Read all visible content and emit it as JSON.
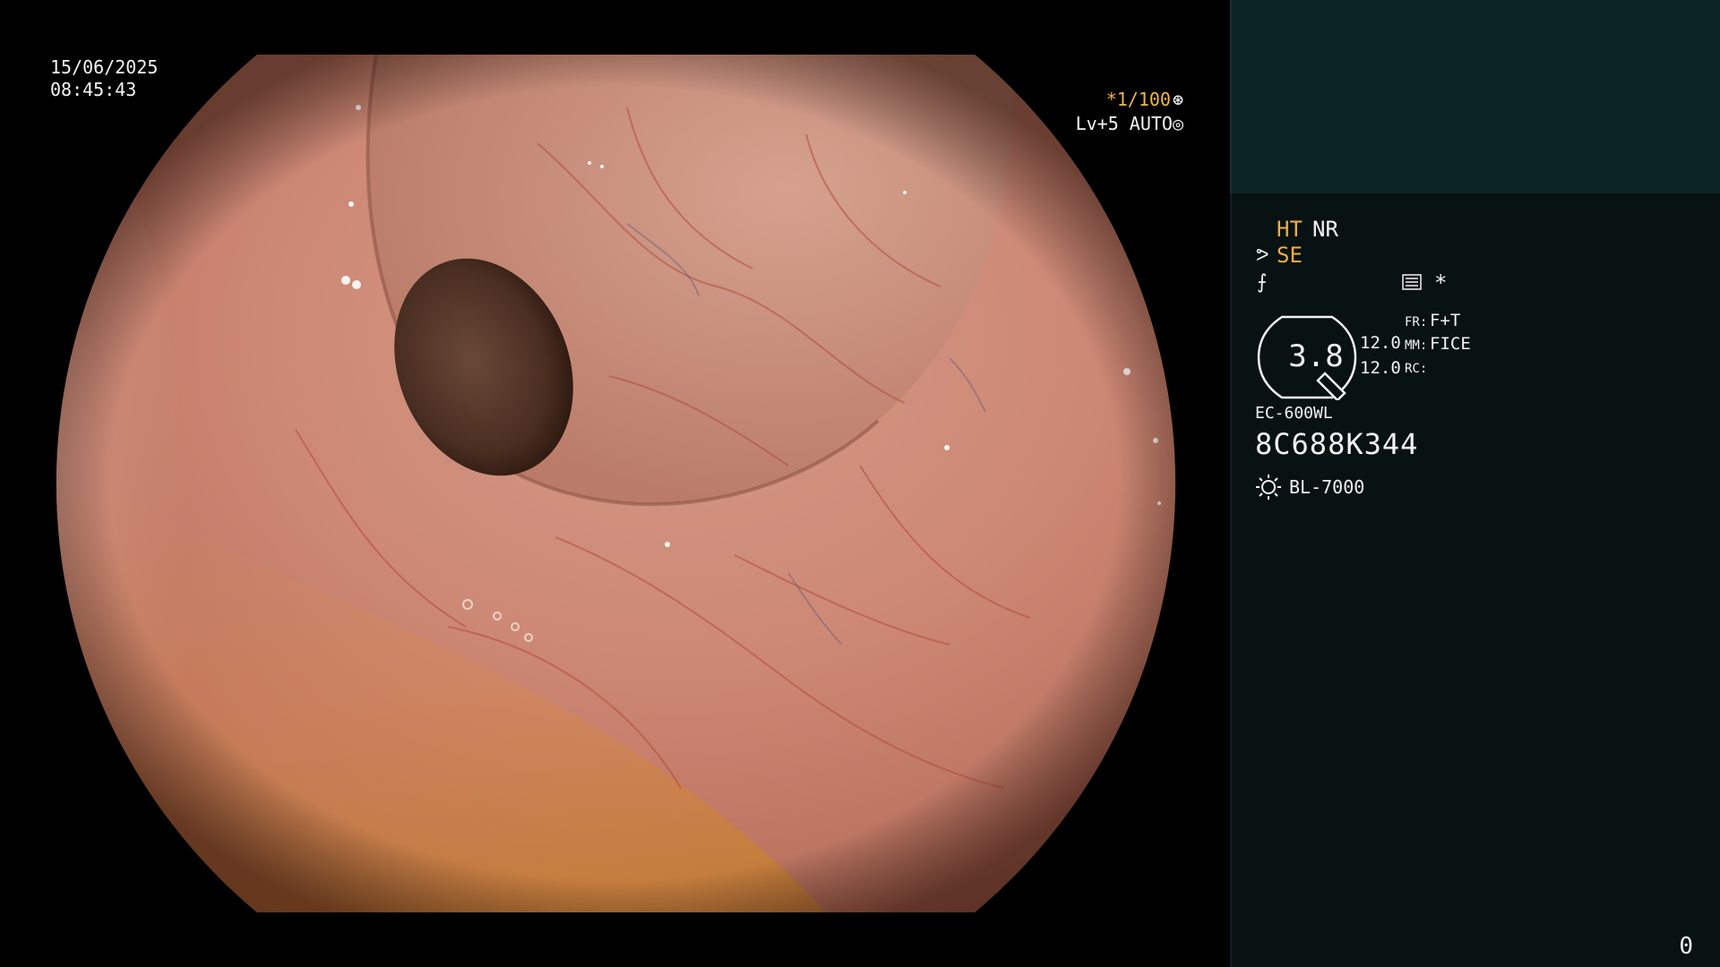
{
  "image": {
    "description_visible_overlay": true
  },
  "overlay": {
    "date": "15/06/2025",
    "time": "08:45:43",
    "shutter": "*1/100",
    "shutter_icon": "⊛",
    "exposure": "Lv+5 AUTO",
    "exposure_icon": "◎"
  },
  "panel": {
    "ht": "HT",
    "nr": "NR",
    "se_icon": "ᕗ",
    "se": "SE",
    "signal_icon": "⨍",
    "menu_icon": "menu-lines-icon",
    "star": "*",
    "dial_value": "3.8",
    "param_value_1": "12.0",
    "param_value_2": "12.0",
    "fr_label": "FR:",
    "fr_value": "F+T",
    "mm_label": "MM:",
    "mm_value": "FICE",
    "rc_label": "RC:",
    "scope_model": "EC-600WL",
    "scope_serial": "8C688K344",
    "light_icon": "sun-icon",
    "light_model": "BL-7000",
    "counter": "0"
  },
  "colors": {
    "accent_orange": "#f0ad45",
    "panel_top": "#0c2426",
    "panel_bg": "#081212",
    "tissue": "#c97c6a"
  }
}
